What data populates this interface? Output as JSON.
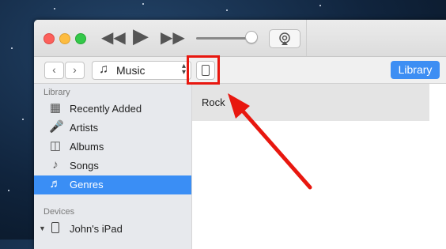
{
  "toolbar": {
    "media_type": "Music",
    "library_label": "Library"
  },
  "sidebar": {
    "library_header": "Library",
    "items": [
      {
        "label": "Recently Added",
        "icon": "grid-icon"
      },
      {
        "label": "Artists",
        "icon": "microphone-icon"
      },
      {
        "label": "Albums",
        "icon": "album-icon"
      },
      {
        "label": "Songs",
        "icon": "music-note-icon"
      },
      {
        "label": "Genres",
        "icon": "guitar-icon",
        "selected": true
      }
    ],
    "devices_header": "Devices",
    "devices": [
      {
        "label": "John's iPad",
        "icon": "ipad-icon"
      }
    ]
  },
  "content": {
    "genres": [
      "Rock"
    ]
  },
  "colors": {
    "accent": "#3a8ef5",
    "annotation": "#e8170f"
  }
}
